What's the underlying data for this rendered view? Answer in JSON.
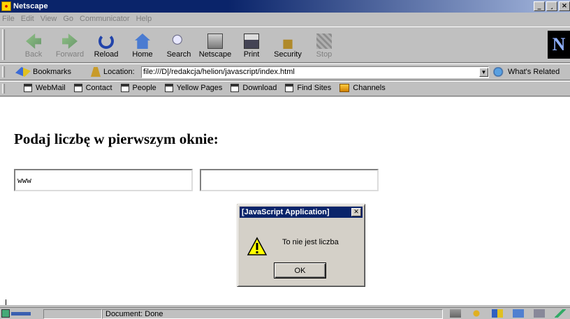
{
  "window": {
    "title": "Netscape",
    "minimize": "_",
    "maximize": "¸",
    "close": "×"
  },
  "menu": [
    "File",
    "Edit",
    "View",
    "Go",
    "Communicator",
    "Help"
  ],
  "nav": {
    "buttons": [
      {
        "label": "Back",
        "icon": "back-arrow-icon",
        "enabled": false
      },
      {
        "label": "Forward",
        "icon": "forward-arrow-icon",
        "enabled": false
      },
      {
        "label": "Reload",
        "icon": "reload-icon",
        "enabled": true
      },
      {
        "label": "Home",
        "icon": "home-icon",
        "enabled": true
      },
      {
        "label": "Search",
        "icon": "search-icon",
        "enabled": true
      },
      {
        "label": "Netscape",
        "icon": "netscape-icon",
        "enabled": true
      },
      {
        "label": "Print",
        "icon": "printer-icon",
        "enabled": true
      },
      {
        "label": "Security",
        "icon": "lock-icon",
        "enabled": true
      },
      {
        "label": "Stop",
        "icon": "stop-icon",
        "enabled": false
      }
    ],
    "logo": "N"
  },
  "location": {
    "bookmarks_label": "Bookmarks",
    "label": "Location:",
    "url": "file:///D|/redakcja/helion/javascript/index.html",
    "related_label": "What's Related"
  },
  "personal": [
    "WebMail",
    "Contact",
    "People",
    "Yellow Pages",
    "Download",
    "Find Sites",
    "Channels"
  ],
  "page": {
    "heading": "Podaj liczbę w pierwszym oknie:",
    "field1_value": "www",
    "field2_value": ""
  },
  "dialog": {
    "title": "[JavaScript Application]",
    "message": "To nie jest liczba",
    "ok_label": "OK"
  },
  "status": {
    "text": "Document: Done"
  },
  "colors": {
    "titlebar": "#0a246a",
    "chrome": "#c0c0c0",
    "dialog": "#d4d0c8"
  }
}
